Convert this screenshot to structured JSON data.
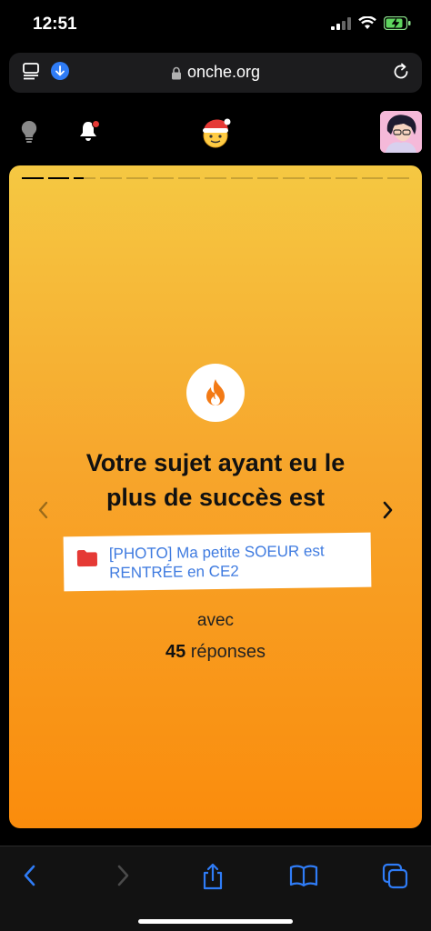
{
  "status": {
    "time": "12:51"
  },
  "browser": {
    "url": "onche.org"
  },
  "card": {
    "title_line1": "Votre sujet ayant eu le",
    "title_line2": "plus de succès est",
    "topic_line1": "[PHOTO] Ma petite SOEUR est",
    "topic_line2": "RENTRÉE en CE2",
    "with_label": "avec",
    "reply_count": "45",
    "reply_label": "réponses",
    "progress": {
      "segments": 15,
      "completed": 2,
      "current_fraction": 0.45
    }
  },
  "colors": {
    "card_top": "#f5c842",
    "card_bottom": "#fa8c0c",
    "link": "#3f7be0",
    "toolbar_icon": "#2f7cf6",
    "flame": "#f37a15"
  },
  "icons": [
    "tabs-icon",
    "download-icon",
    "lock-icon",
    "reload-icon",
    "lightbulb-icon",
    "bell-icon",
    "santa-logo-icon",
    "avatar",
    "flame-icon",
    "chevron-left-icon",
    "chevron-right-icon",
    "folder-icon",
    "back-icon",
    "forward-icon",
    "share-icon",
    "bookmarks-icon",
    "tabs-overview-icon"
  ]
}
